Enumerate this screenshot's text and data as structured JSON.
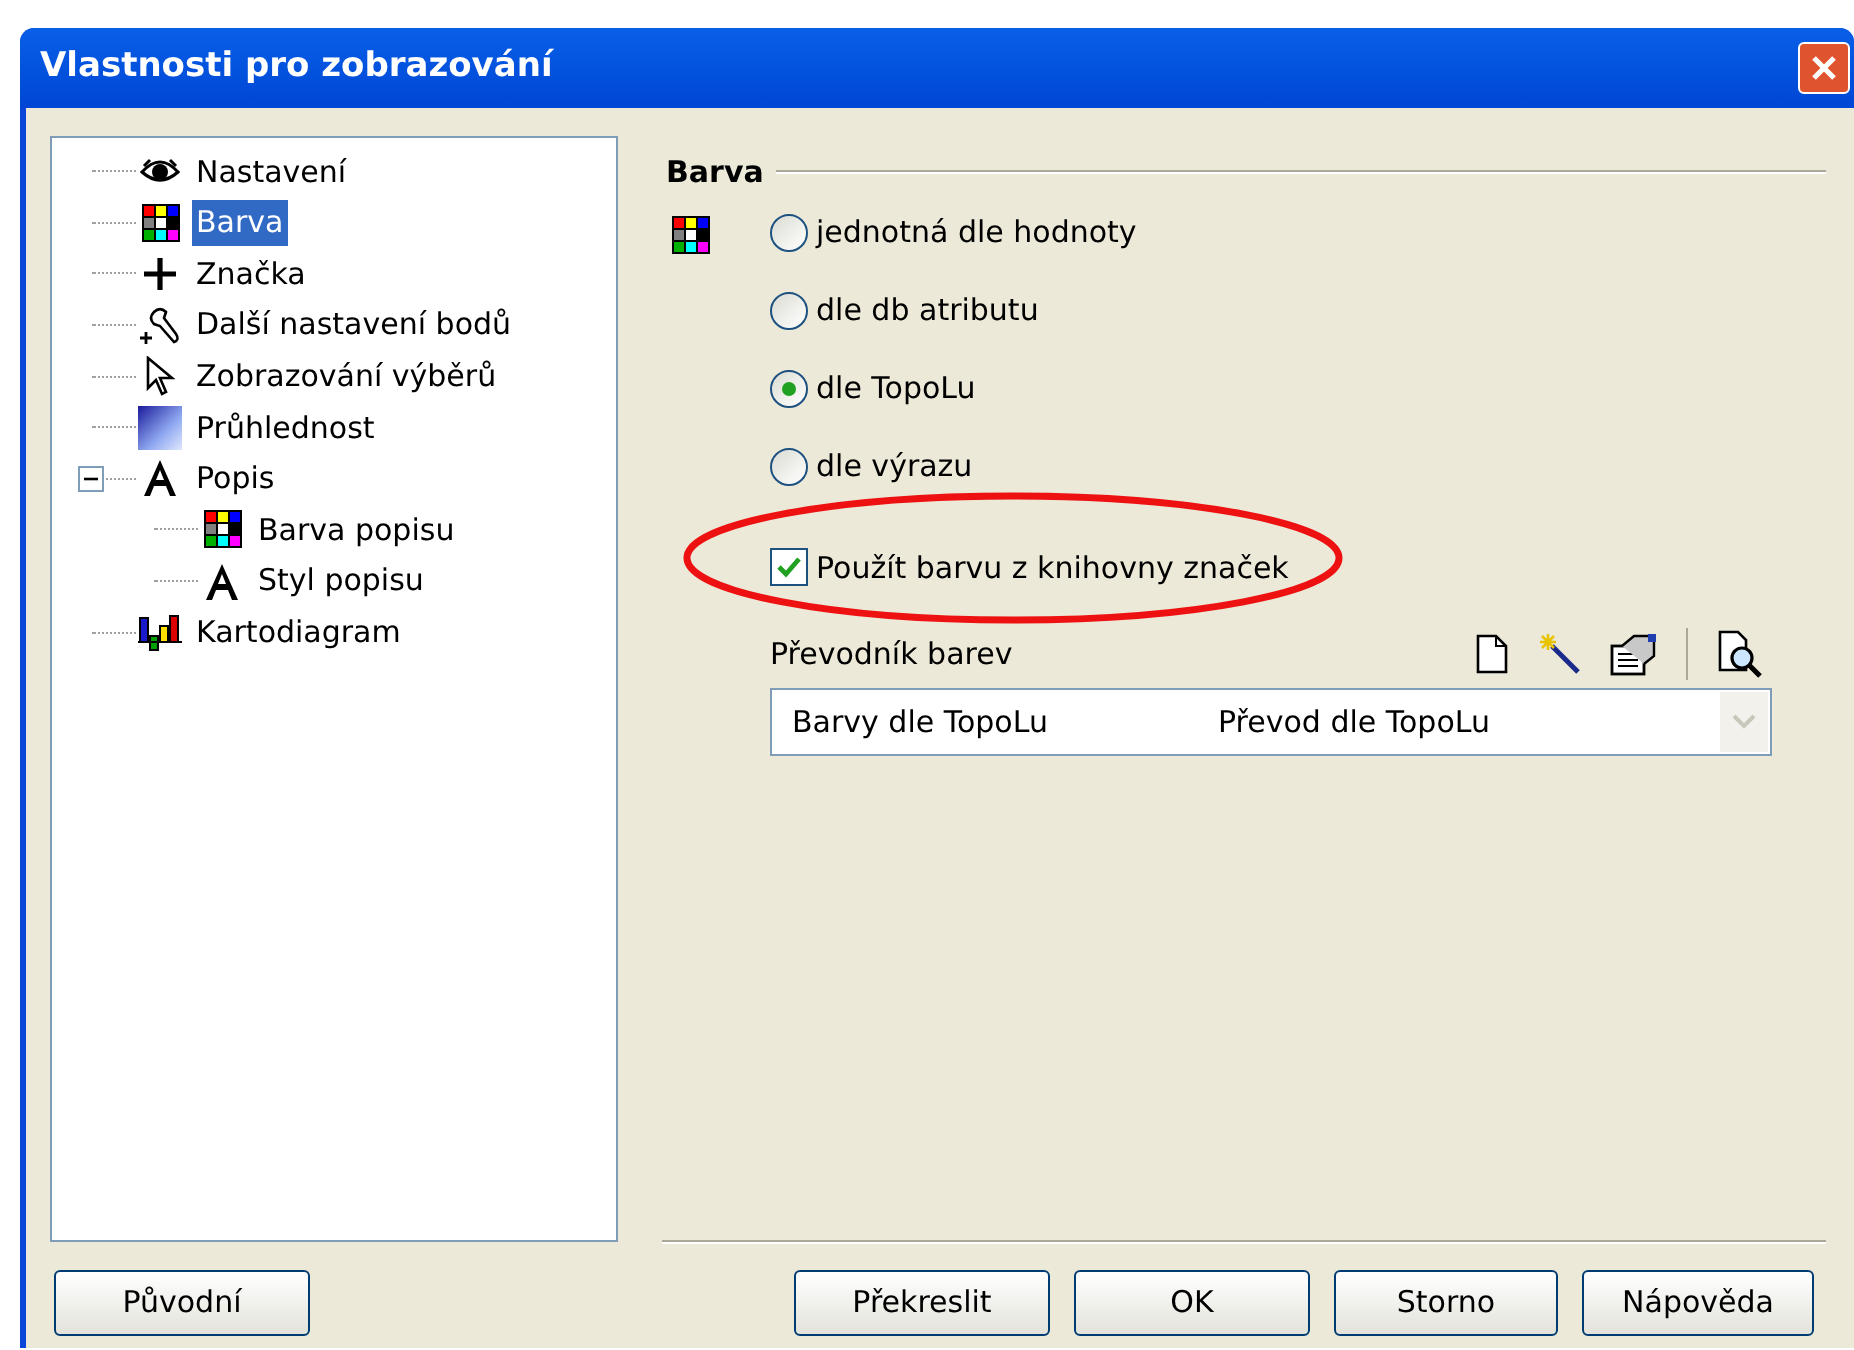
{
  "window": {
    "title": "Vlastnosti pro zobrazování"
  },
  "tree": [
    {
      "label": "Nastavení",
      "kind": "eye",
      "selected": false
    },
    {
      "label": "Barva",
      "kind": "palette",
      "selected": true
    },
    {
      "label": "Značka",
      "kind": "plus",
      "selected": false
    },
    {
      "label": "Další nastavení bodů",
      "kind": "wrench",
      "selected": false
    },
    {
      "label": "Zobrazování výběrů",
      "kind": "cursor",
      "selected": false
    },
    {
      "label": "Průhlednost",
      "kind": "gradient",
      "selected": false
    },
    {
      "label": "Popis",
      "kind": "letter",
      "selected": false,
      "expanded": true,
      "children": [
        {
          "label": "Barva popisu",
          "kind": "palette",
          "selected": false
        },
        {
          "label": "Styl popisu",
          "kind": "letter",
          "selected": false
        }
      ]
    },
    {
      "label": "Kartodiagram",
      "kind": "bars",
      "selected": false
    }
  ],
  "section": {
    "title": "Barva"
  },
  "radios": [
    {
      "label": "jednotná dle hodnoty",
      "selected": false
    },
    {
      "label": "dle db atributu",
      "selected": false
    },
    {
      "label": "dle TopoLu",
      "selected": true
    },
    {
      "label": "dle výrazu",
      "selected": false
    }
  ],
  "checkbox": {
    "label": "Použít barvu z knihovny značek",
    "checked": true
  },
  "converter": {
    "label": "Převodník barev",
    "value": [
      "Barvy dle TopoLu",
      "Převod dle TopoLu"
    ]
  },
  "buttons_left": [
    "Původní"
  ],
  "buttons": [
    "Překreslit",
    "OK",
    "Storno",
    "Nápověda"
  ]
}
